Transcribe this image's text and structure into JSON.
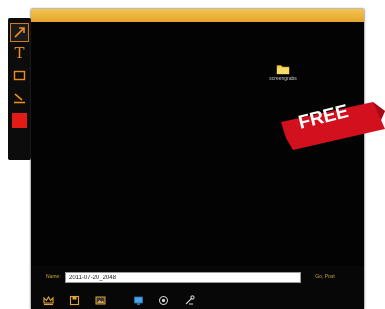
{
  "toolbar": {
    "tools": [
      {
        "name": "arrow-tool",
        "icon": "arrow-icon",
        "selected": true
      },
      {
        "name": "text-tool",
        "icon": "text-icon",
        "glyph": "T"
      },
      {
        "name": "rectangle-tool",
        "icon": "rectangle-icon"
      },
      {
        "name": "highlighter-tool",
        "icon": "highlighter-icon"
      }
    ],
    "current_color": "#e31b17",
    "accent_color": "#ee8c20"
  },
  "desktop": {
    "folder_label": "screengrabs",
    "folder_icon": "folder-icon"
  },
  "save_bar": {
    "name_label": "Name:",
    "filename_value": "2011-07-20_2048",
    "go_label": "Go, Post"
  },
  "bottom_icons": [
    "crown-icon",
    "save-icon",
    "image-icon",
    "screen-icon",
    "settings-icon",
    "tools-icon"
  ],
  "badge": {
    "text": "FREE",
    "color": "#d2101e"
  }
}
